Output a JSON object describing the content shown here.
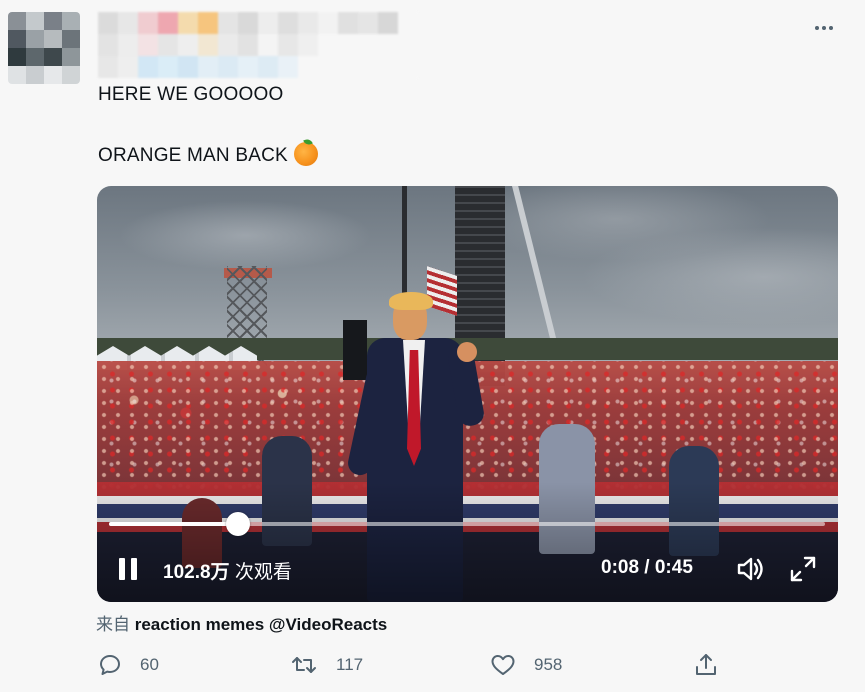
{
  "tweet": {
    "line1": "HERE WE GOOOOO",
    "line2": "ORANGE MAN BACK",
    "emoji": "orange-emoji"
  },
  "video": {
    "view_count": "102.8万",
    "view_unit": "次观看",
    "time_display": "0:08 / 0:45",
    "progress": 0.18,
    "icons": [
      "pause-icon",
      "volume-icon",
      "fullscreen-icon"
    ]
  },
  "source": {
    "prefix": "来自",
    "account": "reaction memes @VideoReacts"
  },
  "actions": {
    "reply_count": "60",
    "retweet_count": "117",
    "like_count": "958",
    "icons": [
      "reply-icon",
      "retweet-icon",
      "like-icon",
      "share-icon"
    ]
  },
  "colors": {
    "background": "#f7f7f7",
    "text": "#0f1419",
    "secondary": "#536471"
  }
}
